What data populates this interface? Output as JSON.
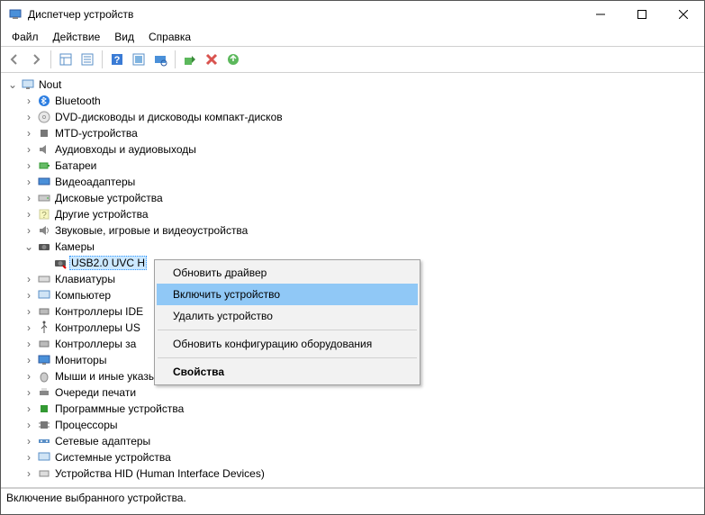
{
  "title": "Диспетчер устройств",
  "menu": {
    "file": "Файл",
    "action": "Действие",
    "view": "Вид",
    "help": "Справка"
  },
  "root": "Nout",
  "nodes": {
    "bluetooth": "Bluetooth",
    "dvd": "DVD-дисководы и дисководы компакт-дисков",
    "mtd": "MTD-устройства",
    "audio": "Аудиовходы и аудиовыходы",
    "battery": "Батареи",
    "video": "Видеоадаптеры",
    "disk": "Дисковые устройства",
    "other": "Другие устройства",
    "sound": "Звуковые, игровые и видеоустройства",
    "cameras": "Камеры",
    "camera_device": "USB2.0 UVC H",
    "keyboard": "Клавиатуры",
    "computer": "Компьютер",
    "ide": "Контроллеры IDE",
    "usb": "Контроллеры US",
    "storage": "Контроллеры за",
    "monitor": "Мониторы",
    "mouse": "Мыши и иные указывающие устройства",
    "printq": "Очереди печати",
    "soft": "Программные устройства",
    "cpu": "Процессоры",
    "net": "Сетевые адаптеры",
    "sys": "Системные устройства",
    "hid": "Устройства HID (Human Interface Devices)"
  },
  "ctx": {
    "update": "Обновить драйвер",
    "enable": "Включить устройство",
    "delete": "Удалить устройство",
    "scan": "Обновить конфигурацию оборудования",
    "props": "Свойства"
  },
  "status": "Включение выбранного устройства."
}
